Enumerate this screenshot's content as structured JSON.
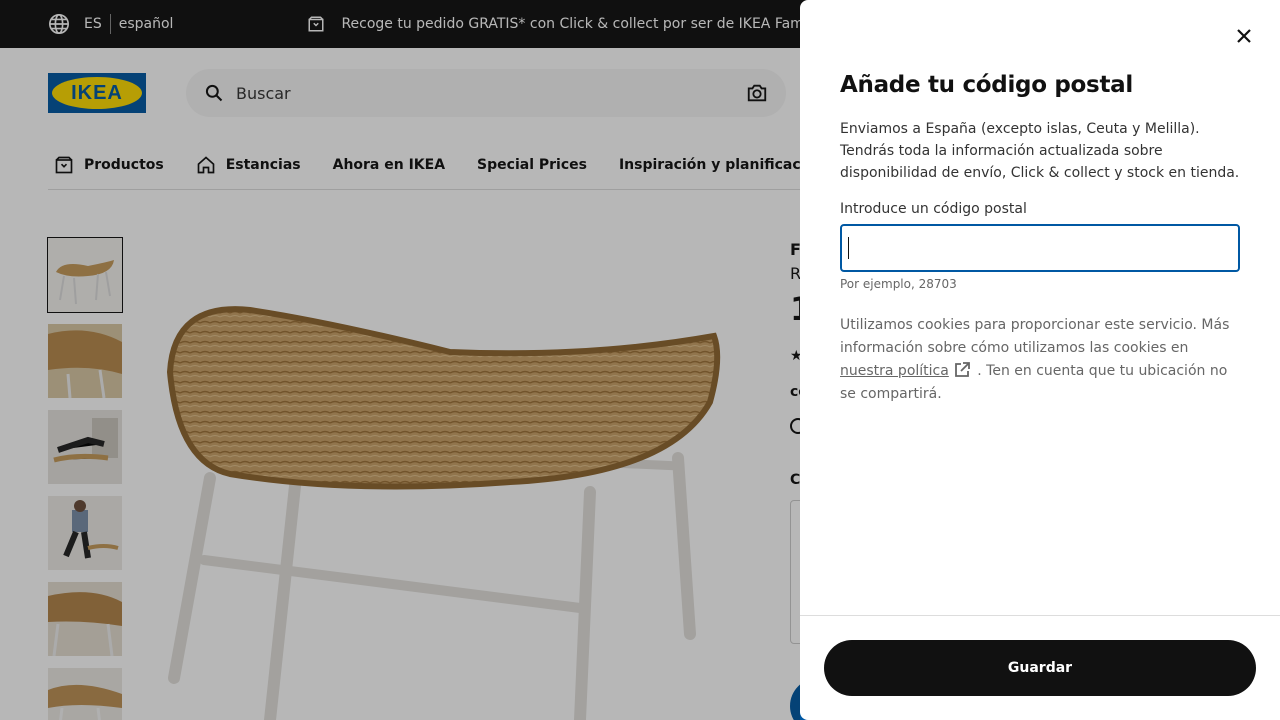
{
  "topbar": {
    "lang_code": "ES",
    "lang_name": "español",
    "promo_text": "Recoge tu pedido GRATIS* con Click & collect por ser de IKEA Family"
  },
  "header": {
    "logo_text": "IKEA",
    "search_placeholder": "Buscar"
  },
  "nav": {
    "items": [
      {
        "label": "Productos",
        "icon": "box-icon"
      },
      {
        "label": "Estancias",
        "icon": "home-icon"
      },
      {
        "label": "Ahora en IKEA"
      },
      {
        "label": "Special Prices"
      },
      {
        "label": "Inspiración y planificación"
      }
    ]
  },
  "product": {
    "name_partial": "F",
    "sub_partial": "R",
    "price_partial": "1",
    "label_partial_1": "co",
    "label_partial_2": "C"
  },
  "modal": {
    "title": "Añade tu código postal",
    "description": "Enviamos a España (excepto islas, Ceuta y Melilla). Tendrás toda la información actualizada sobre disponibilidad de envío, Click & collect y stock en tienda.",
    "field_label": "Introduce un código postal",
    "field_value": "",
    "field_hint": "Por ejemplo, 28703",
    "cookie_text_1": "Utilizamos cookies para proporcionar este servicio. Más información sobre cómo utilizamos las cookies en",
    "cookie_link": "nuestra política",
    "cookie_text_2": ". Ten en cuenta que tu ubicación no se compartirá.",
    "save_label": "Guardar"
  },
  "colors": {
    "brand_blue": "#0058a3",
    "brand_yellow": "#ffdb00",
    "dark": "#111111"
  }
}
